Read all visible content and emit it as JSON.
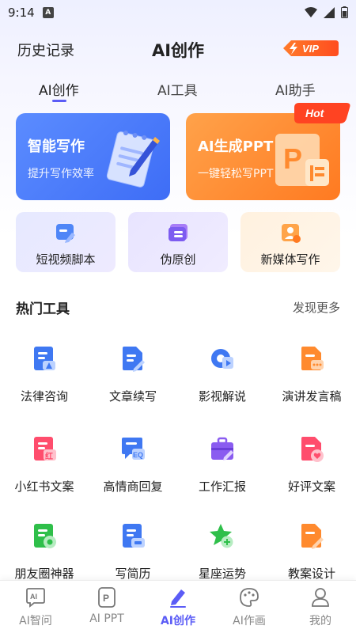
{
  "status_bar": {
    "time": "9:14",
    "badge": "A"
  },
  "header": {
    "history": "历史记录",
    "title": "AI创作",
    "vip": "VIP"
  },
  "tabs": [
    {
      "label": "AI创作"
    },
    {
      "label": "AI工具"
    },
    {
      "label": "AI助手"
    }
  ],
  "feature_cards": [
    {
      "title": "智能写作",
      "subtitle": "提升写作效率"
    },
    {
      "title": "AI生成PPT",
      "subtitle": "一键轻松写PPT",
      "badge": "Hot"
    }
  ],
  "quick_cards": [
    {
      "label": "短视频脚本",
      "icon": "video-script-icon"
    },
    {
      "label": "伪原创",
      "icon": "rewrite-icon"
    },
    {
      "label": "新媒体写作",
      "icon": "new-media-icon"
    }
  ],
  "hot_tools": {
    "title": "热门工具",
    "more": "发现更多",
    "items": [
      {
        "label": "法律咨询",
        "icon": "law-doc-icon"
      },
      {
        "label": "文章续写",
        "icon": "doc-edit-icon"
      },
      {
        "label": "影视解说",
        "icon": "film-icon"
      },
      {
        "label": "演讲发言稿",
        "icon": "speech-doc-icon"
      },
      {
        "label": "小红书文案",
        "icon": "xiaohongshu-icon"
      },
      {
        "label": "高情商回复",
        "icon": "eq-reply-icon"
      },
      {
        "label": "工作汇报",
        "icon": "briefcase-icon"
      },
      {
        "label": "好评文案",
        "icon": "heart-doc-icon"
      },
      {
        "label": "朋友圈神器",
        "icon": "moments-icon"
      },
      {
        "label": "写简历",
        "icon": "resume-icon"
      },
      {
        "label": "星座运势",
        "icon": "star-icon"
      },
      {
        "label": "教案设计",
        "icon": "lesson-plan-icon"
      }
    ]
  },
  "bottom_nav": [
    {
      "label": "AI智问"
    },
    {
      "label": "AI PPT"
    },
    {
      "label": "AI创作"
    },
    {
      "label": "AI作画"
    },
    {
      "label": "我的"
    }
  ],
  "colors": {
    "accent": "#5b5cf6",
    "blue_card": "#4a7af8",
    "orange_card": "#ff8a2e",
    "hot_red": "#ff4a2a"
  }
}
